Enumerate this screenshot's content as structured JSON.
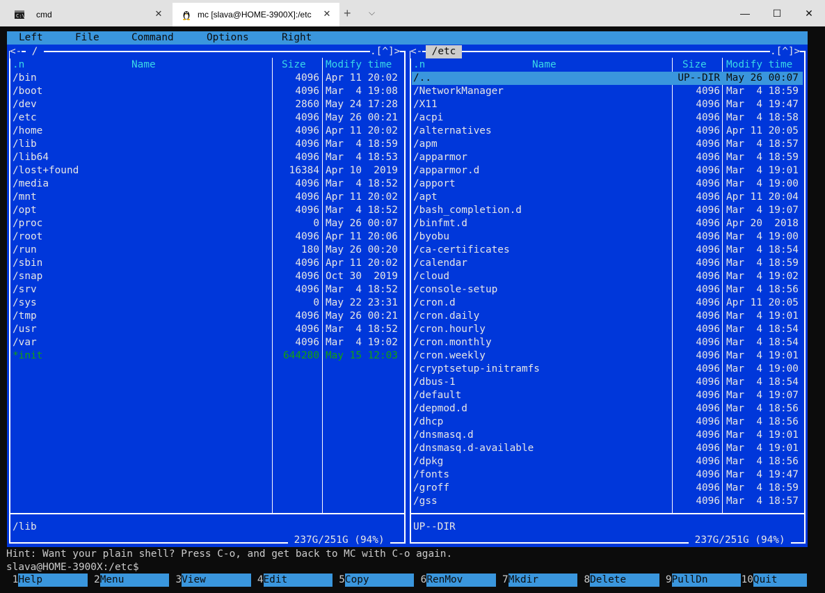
{
  "tabs": [
    {
      "title": "cmd",
      "icon": "cmd-icon"
    },
    {
      "title": "mc [slava@HOME-3900X]:/etc",
      "icon": "linux-penguin-icon"
    }
  ],
  "window_controls": {
    "minimize": "—",
    "maximize": "☐",
    "close": "✕"
  },
  "menu": [
    "Left",
    "File",
    "Command",
    "Options",
    "Right"
  ],
  "left_panel": {
    "path": " / ",
    "top_left": "<-",
    "top_right": ".[^]>",
    "headers": {
      "sort": ".n",
      "name": "Name",
      "size": "Size",
      "mtime": "Modify time"
    },
    "entries": [
      {
        "name": "/bin",
        "size": "4096",
        "date": "Apr 11 20:02"
      },
      {
        "name": "/boot",
        "size": "4096",
        "date": "Mar  4 19:08"
      },
      {
        "name": "/dev",
        "size": "2860",
        "date": "May 24 17:28"
      },
      {
        "name": "/etc",
        "size": "4096",
        "date": "May 26 00:21"
      },
      {
        "name": "/home",
        "size": "4096",
        "date": "Apr 11 20:02"
      },
      {
        "name": "/lib",
        "size": "4096",
        "date": "Mar  4 18:59"
      },
      {
        "name": "/lib64",
        "size": "4096",
        "date": "Mar  4 18:53"
      },
      {
        "name": "/lost+found",
        "size": "16384",
        "date": "Apr 10  2019"
      },
      {
        "name": "/media",
        "size": "4096",
        "date": "Mar  4 18:52"
      },
      {
        "name": "/mnt",
        "size": "4096",
        "date": "Apr 11 20:02"
      },
      {
        "name": "/opt",
        "size": "4096",
        "date": "Mar  4 18:52"
      },
      {
        "name": "/proc",
        "size": "0",
        "date": "May 26 00:07"
      },
      {
        "name": "/root",
        "size": "4096",
        "date": "Apr 11 20:06"
      },
      {
        "name": "/run",
        "size": "180",
        "date": "May 26 00:20"
      },
      {
        "name": "/sbin",
        "size": "4096",
        "date": "Apr 11 20:02"
      },
      {
        "name": "/snap",
        "size": "4096",
        "date": "Oct 30  2019"
      },
      {
        "name": "/srv",
        "size": "4096",
        "date": "Mar  4 18:52"
      },
      {
        "name": "/sys",
        "size": "0",
        "date": "May 22 23:31"
      },
      {
        "name": "/tmp",
        "size": "4096",
        "date": "May 26 00:21"
      },
      {
        "name": "/usr",
        "size": "4096",
        "date": "Mar  4 18:52"
      },
      {
        "name": "/var",
        "size": "4096",
        "date": "Mar  4 19:02"
      },
      {
        "name": "*init",
        "size": "644280",
        "date": "May 15 12:03",
        "type": "exec"
      }
    ],
    "mini_status": "/lib",
    "disk": " 237G/251G (94%) "
  },
  "right_panel": {
    "path": " /etc ",
    "top_left": "<-",
    "top_right": ".[^]>",
    "headers": {
      "sort": ".n",
      "name": "Name",
      "size": "Size",
      "mtime": "Modify time"
    },
    "entries": [
      {
        "name": "/..",
        "size": "UP--DIR",
        "date": "May 26 00:07",
        "selected": true
      },
      {
        "name": "/NetworkManager",
        "size": "4096",
        "date": "Mar  4 18:59"
      },
      {
        "name": "/X11",
        "size": "4096",
        "date": "Mar  4 19:47"
      },
      {
        "name": "/acpi",
        "size": "4096",
        "date": "Mar  4 18:58"
      },
      {
        "name": "/alternatives",
        "size": "4096",
        "date": "Apr 11 20:05"
      },
      {
        "name": "/apm",
        "size": "4096",
        "date": "Mar  4 18:57"
      },
      {
        "name": "/apparmor",
        "size": "4096",
        "date": "Mar  4 18:59"
      },
      {
        "name": "/apparmor.d",
        "size": "4096",
        "date": "Mar  4 19:01"
      },
      {
        "name": "/apport",
        "size": "4096",
        "date": "Mar  4 19:00"
      },
      {
        "name": "/apt",
        "size": "4096",
        "date": "Apr 11 20:04"
      },
      {
        "name": "/bash_completion.d",
        "size": "4096",
        "date": "Mar  4 19:07"
      },
      {
        "name": "/binfmt.d",
        "size": "4096",
        "date": "Apr 20  2018"
      },
      {
        "name": "/byobu",
        "size": "4096",
        "date": "Mar  4 19:00"
      },
      {
        "name": "/ca-certificates",
        "size": "4096",
        "date": "Mar  4 18:54"
      },
      {
        "name": "/calendar",
        "size": "4096",
        "date": "Mar  4 18:59"
      },
      {
        "name": "/cloud",
        "size": "4096",
        "date": "Mar  4 19:02"
      },
      {
        "name": "/console-setup",
        "size": "4096",
        "date": "Mar  4 18:56"
      },
      {
        "name": "/cron.d",
        "size": "4096",
        "date": "Apr 11 20:05"
      },
      {
        "name": "/cron.daily",
        "size": "4096",
        "date": "Mar  4 19:01"
      },
      {
        "name": "/cron.hourly",
        "size": "4096",
        "date": "Mar  4 18:54"
      },
      {
        "name": "/cron.monthly",
        "size": "4096",
        "date": "Mar  4 18:54"
      },
      {
        "name": "/cron.weekly",
        "size": "4096",
        "date": "Mar  4 19:01"
      },
      {
        "name": "/cryptsetup-initramfs",
        "size": "4096",
        "date": "Mar  4 19:00"
      },
      {
        "name": "/dbus-1",
        "size": "4096",
        "date": "Mar  4 18:54"
      },
      {
        "name": "/default",
        "size": "4096",
        "date": "Mar  4 19:07"
      },
      {
        "name": "/depmod.d",
        "size": "4096",
        "date": "Mar  4 18:56"
      },
      {
        "name": "/dhcp",
        "size": "4096",
        "date": "Mar  4 18:56"
      },
      {
        "name": "/dnsmasq.d",
        "size": "4096",
        "date": "Mar  4 19:01"
      },
      {
        "name": "/dnsmasq.d-available",
        "size": "4096",
        "date": "Mar  4 19:01"
      },
      {
        "name": "/dpkg",
        "size": "4096",
        "date": "Mar  4 18:56"
      },
      {
        "name": "/fonts",
        "size": "4096",
        "date": "Mar  4 19:47"
      },
      {
        "name": "/groff",
        "size": "4096",
        "date": "Mar  4 18:59"
      },
      {
        "name": "/gss",
        "size": "4096",
        "date": "Mar  4 18:57"
      }
    ],
    "mini_status": "UP--DIR",
    "disk": " 237G/251G (94%) "
  },
  "hint": "Hint: Want your plain shell? Press C-o, and get back to MC with C-o again.",
  "prompt": "slava@HOME-3900X:/etc$",
  "fkeys": [
    {
      "num": "1",
      "label": "Help"
    },
    {
      "num": "2",
      "label": "Menu"
    },
    {
      "num": "3",
      "label": "View"
    },
    {
      "num": "4",
      "label": "Edit"
    },
    {
      "num": "5",
      "label": "Copy"
    },
    {
      "num": "6",
      "label": "RenMov"
    },
    {
      "num": "7",
      "label": "Mkdir"
    },
    {
      "num": "8",
      "label": "Delete"
    },
    {
      "num": "9",
      "label": "PullDn"
    },
    {
      "num": "10",
      "label": "Quit"
    }
  ],
  "colors": {
    "panel_bg": "#0037da",
    "menu_bg": "#3a96dd",
    "selection_bg": "#3a96dd",
    "header_text": "#3ad8e6",
    "exec_text": "#13a10e",
    "terminal_bg": "#0c0c0c"
  }
}
